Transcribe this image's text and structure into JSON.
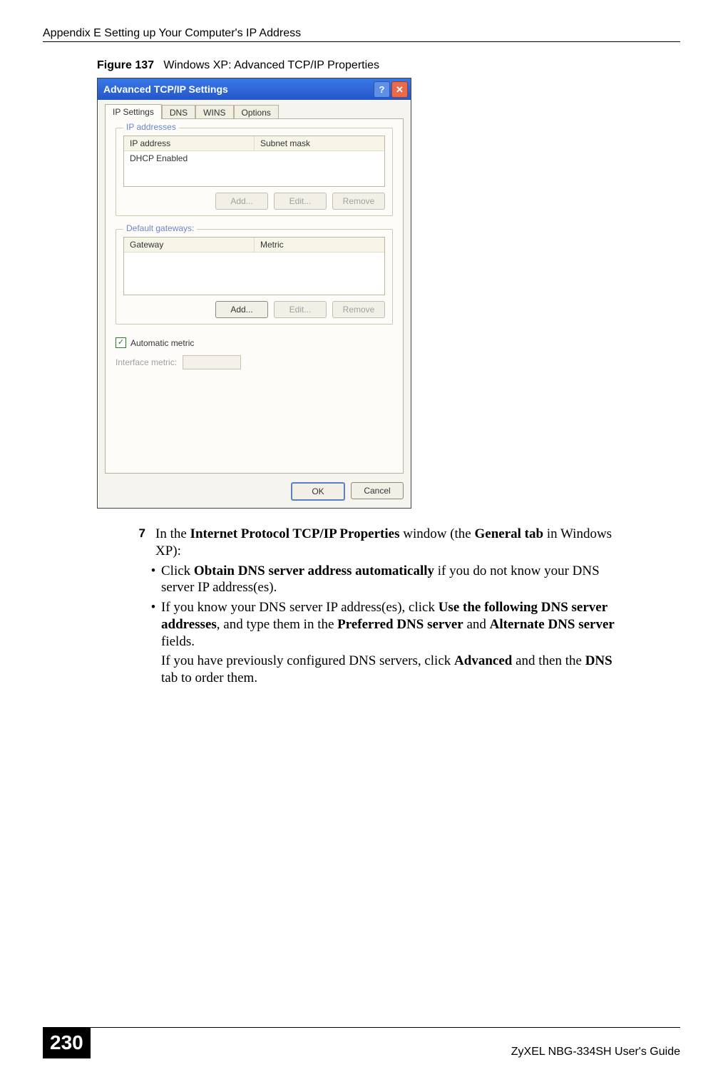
{
  "header": {
    "left": "Appendix E Setting up Your Computer's IP Address",
    "right": ""
  },
  "figure": {
    "label": "Figure 137",
    "caption": "Windows XP: Advanced TCP/IP Properties"
  },
  "dialog": {
    "title": "Advanced TCP/IP Settings",
    "tabs": [
      "IP Settings",
      "DNS",
      "WINS",
      "Options"
    ],
    "group_ip": {
      "title": "IP addresses",
      "col1": "IP address",
      "col2": "Subnet mask",
      "row1": "DHCP Enabled",
      "add": "Add...",
      "edit": "Edit...",
      "remove": "Remove"
    },
    "group_gw": {
      "title": "Default gateways:",
      "col1": "Gateway",
      "col2": "Metric",
      "add": "Add...",
      "edit": "Edit...",
      "remove": "Remove"
    },
    "auto_metric": "Automatic metric",
    "interface_metric": "Interface metric:",
    "ok": "OK",
    "cancel": "Cancel"
  },
  "step": {
    "num": "7",
    "intro_a": "In the ",
    "intro_b": "Internet Protocol TCP/IP Properties",
    "intro_c": " window (the ",
    "intro_d": "General tab",
    "intro_e": " in Windows XP):",
    "b1_a": "Click ",
    "b1_b": "Obtain DNS server address automatically",
    "b1_c": " if you do not know your DNS server IP address(es).",
    "b2_a": "If you know your DNS server IP address(es), click ",
    "b2_b": "Use the following DNS server addresses",
    "b2_c": ", and type them in the ",
    "b2_d": "Preferred DNS server",
    "b2_e": " and ",
    "b2_f": "Alternate DNS server",
    "b2_g": " fields.",
    "b2_p2a": "If you have previously configured DNS servers, click ",
    "b2_p2b": "Advanced",
    "b2_p2c": " and then the ",
    "b2_p2d": "DNS",
    "b2_p2e": " tab to order them."
  },
  "footer": {
    "page": "230",
    "guide": "ZyXEL NBG-334SH User's Guide"
  }
}
